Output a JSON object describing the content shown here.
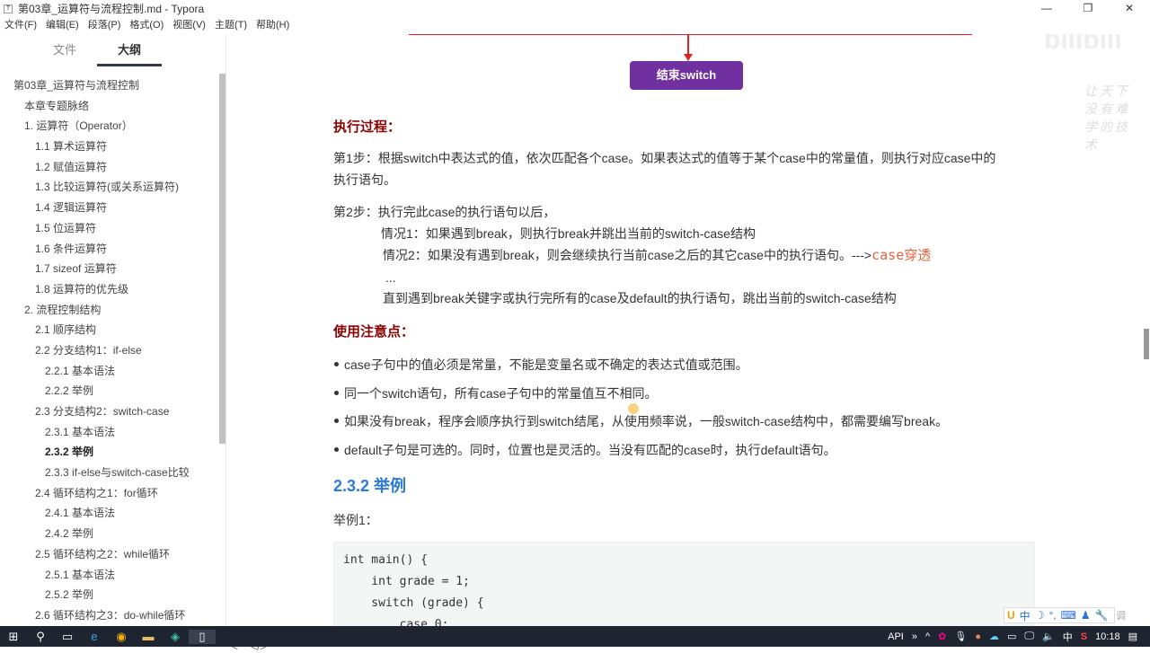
{
  "window": {
    "title": "第03章_运算符与流程控制.md - Typora",
    "app_icon": "T",
    "controls": [
      "—",
      "❐",
      "✕"
    ]
  },
  "menu": [
    "文件(F)",
    "编辑(E)",
    "段落(P)",
    "格式(O)",
    "视图(V)",
    "主题(T)",
    "帮助(H)"
  ],
  "sidebar": {
    "tabs": [
      "文件",
      "大纲"
    ],
    "active_tab": "大纲",
    "outline": [
      {
        "label": "第03章_运算符与流程控制",
        "level": 0
      },
      {
        "label": "本章专题脉络",
        "level": 1
      },
      {
        "label": "1. 运算符（Operator）",
        "level": 1
      },
      {
        "label": "1.1 算术运算符",
        "level": 2
      },
      {
        "label": "1.2 赋值运算符",
        "level": 2
      },
      {
        "label": "1.3 比较运算符(或关系运算符)",
        "level": 2
      },
      {
        "label": "1.4 逻辑运算符",
        "level": 2
      },
      {
        "label": "1.5 位运算符",
        "level": 2
      },
      {
        "label": "1.6 条件运算符",
        "level": 2
      },
      {
        "label": "1.7 sizeof 运算符",
        "level": 2
      },
      {
        "label": "1.8 运算符的优先级",
        "level": 2
      },
      {
        "label": "2. 流程控制结构",
        "level": 1
      },
      {
        "label": "2.1 顺序结构",
        "level": 2
      },
      {
        "label": "2.2 分支结构1：if-else",
        "level": 2
      },
      {
        "label": "2.2.1 基本语法",
        "level": 3
      },
      {
        "label": "2.2.2 举例",
        "level": 3
      },
      {
        "label": "2.3 分支结构2：switch-case",
        "level": 2
      },
      {
        "label": "2.3.1 基本语法",
        "level": 3
      },
      {
        "label": "2.3.2 举例",
        "level": 3,
        "current": true
      },
      {
        "label": "2.3.3 if-else与switch-case比较",
        "level": 3
      },
      {
        "label": "2.4 循环结构之1：for循环",
        "level": 2
      },
      {
        "label": "2.4.1 基本语法",
        "level": 3
      },
      {
        "label": "2.4.2 举例",
        "level": 3
      },
      {
        "label": "2.5 循环结构之2：while循环",
        "level": 2
      },
      {
        "label": "2.5.1 基本语法",
        "level": 3
      },
      {
        "label": "2.5.2 举例",
        "level": 3
      },
      {
        "label": "2.6 循环结构之3：do-while循环",
        "level": 2
      }
    ],
    "footer": [
      "<",
      "</>"
    ]
  },
  "diagram": {
    "end_box": "结束switch"
  },
  "watermark": {
    "logo": "bilibili",
    "text": "让天下没有难学的技术"
  },
  "doc": {
    "exec_title": "执行过程：",
    "step1": "第1步：根据switch中表达式的值，依次匹配各个case。如果表达式的值等于某个case中的常量值，则执行对应case中的",
    "step1b": "执行语句。",
    "step2": "第2步：执行完此case的执行语句以后，",
    "case1": "情况1：如果遇到break，则执行break并跳出当前的switch-case结构",
    "case2": "情况2：如果没有遇到break，则会继续执行当前case之后的其它case中的执行语句。--->",
    "case2_hl": "case穿透",
    "ellipsis": "...",
    "until": "直到遇到break关键字或执行完所有的case及default的执行语句，跳出当前的switch-case结构",
    "notes_title": "使用注意点：",
    "notes": [
      "case子句中的值必须是常量，不能是变量名或不确定的表达式值或范围。",
      "同一个switch语句，所有case子句中的常量值互不相同。",
      "如果没有break，程序会顺序执行到switch结尾，从使用频率说，一般switch-case结构中，都需要编写break。",
      "default子句是可选的。同时，位置也是灵活的。当没有匹配的case时，执行default语句。"
    ],
    "section": "2.3.2 举例",
    "example": "举例1：",
    "code": [
      "int main() {",
      "    int grade = 1;",
      "    switch (grade) {",
      "        case 0:"
    ]
  },
  "ime": {
    "items": [
      "中",
      "☽",
      "°,",
      "⌨",
      "♟",
      "🔧"
    ],
    "extra": "调"
  },
  "taskbar": {
    "tray_label": "API",
    "ime": "中",
    "time": "10:18"
  }
}
